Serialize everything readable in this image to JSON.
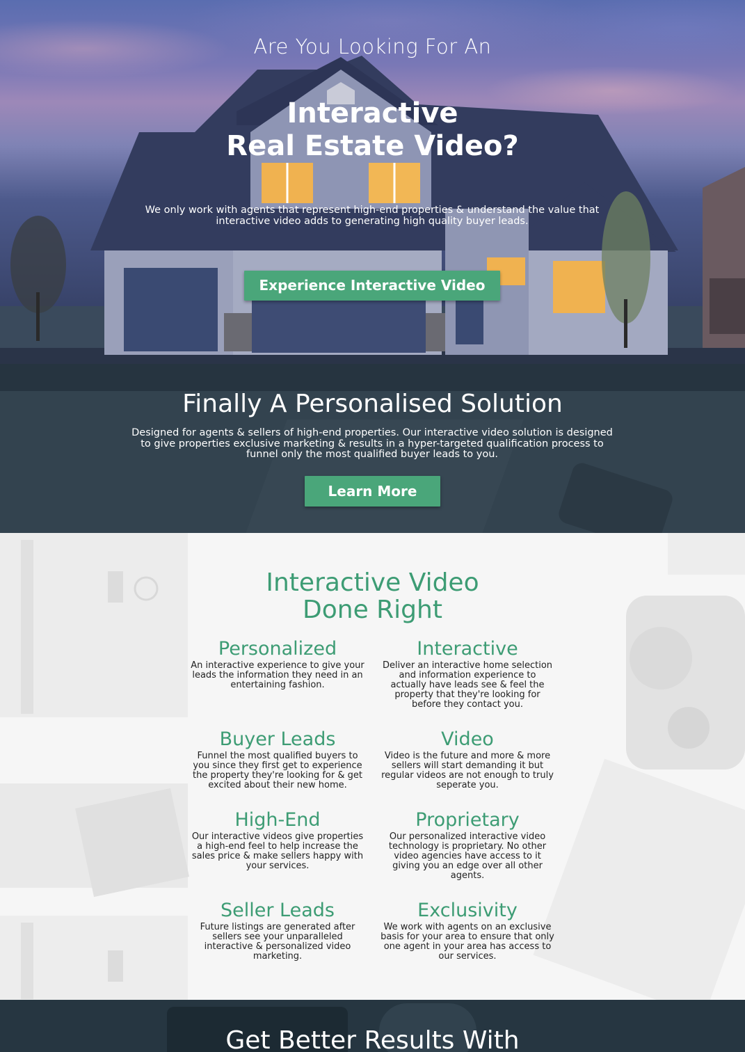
{
  "hero": {
    "kicker": "Are You Looking For An",
    "title_line1": "Interactive",
    "title_line2": "Real Estate Video?",
    "subtitle": "We only work with agents that represent high-end properties & understand the value that interactive video adds to generating high quality buyer leads.",
    "cta": "Experience Interactive Video"
  },
  "solution": {
    "title": "Finally A Personalised Solution",
    "text": "Designed for agents & sellers of high-end properties. Our interactive video solution is designed to give properties exclusive marketing & results in a hyper-targeted qualification process to funnel only the most qualified buyer leads to you.",
    "cta": "Learn More"
  },
  "features": {
    "title_line1": "Interactive Video",
    "title_line2": "Done Right",
    "items": [
      {
        "title": "Personalized",
        "text": "An interactive experience to give your leads the information they need in an entertaining fashion."
      },
      {
        "title": "Interactive",
        "text": "Deliver an interactive home selection and information experience to actually have leads see & feel the property that they're looking for before they contact you."
      },
      {
        "title": "Buyer Leads",
        "text": "Funnel the most qualified buyers to you since they first get to experience the property they're looking for & get excited about their new home."
      },
      {
        "title": "Video",
        "text": "Video is the future and more & more sellers will start demanding it but regular videos are not enough to truly seperate you."
      },
      {
        "title": "High-End",
        "text": "Our interactive videos give properties a high-end feel to help increase the sales price & make sellers happy with your services."
      },
      {
        "title": "Proprietary",
        "text": "Our personalized interactive video technology is proprietary. No other video agencies have access to it giving you an edge over all other agents."
      },
      {
        "title": "Seller Leads",
        "text": "Future listings are generated after sellers see your unparalleled interactive & personalized video marketing."
      },
      {
        "title": "Exclusivity",
        "text": "We work with agents on an exclusive basis for your area to ensure that only one agent in your area has access to our services."
      }
    ]
  },
  "bottom": {
    "title": "Get Better Results With"
  },
  "colors": {
    "accent": "#4aa67a",
    "heading_green": "#3d9c74",
    "dark_band": "#33434f"
  }
}
